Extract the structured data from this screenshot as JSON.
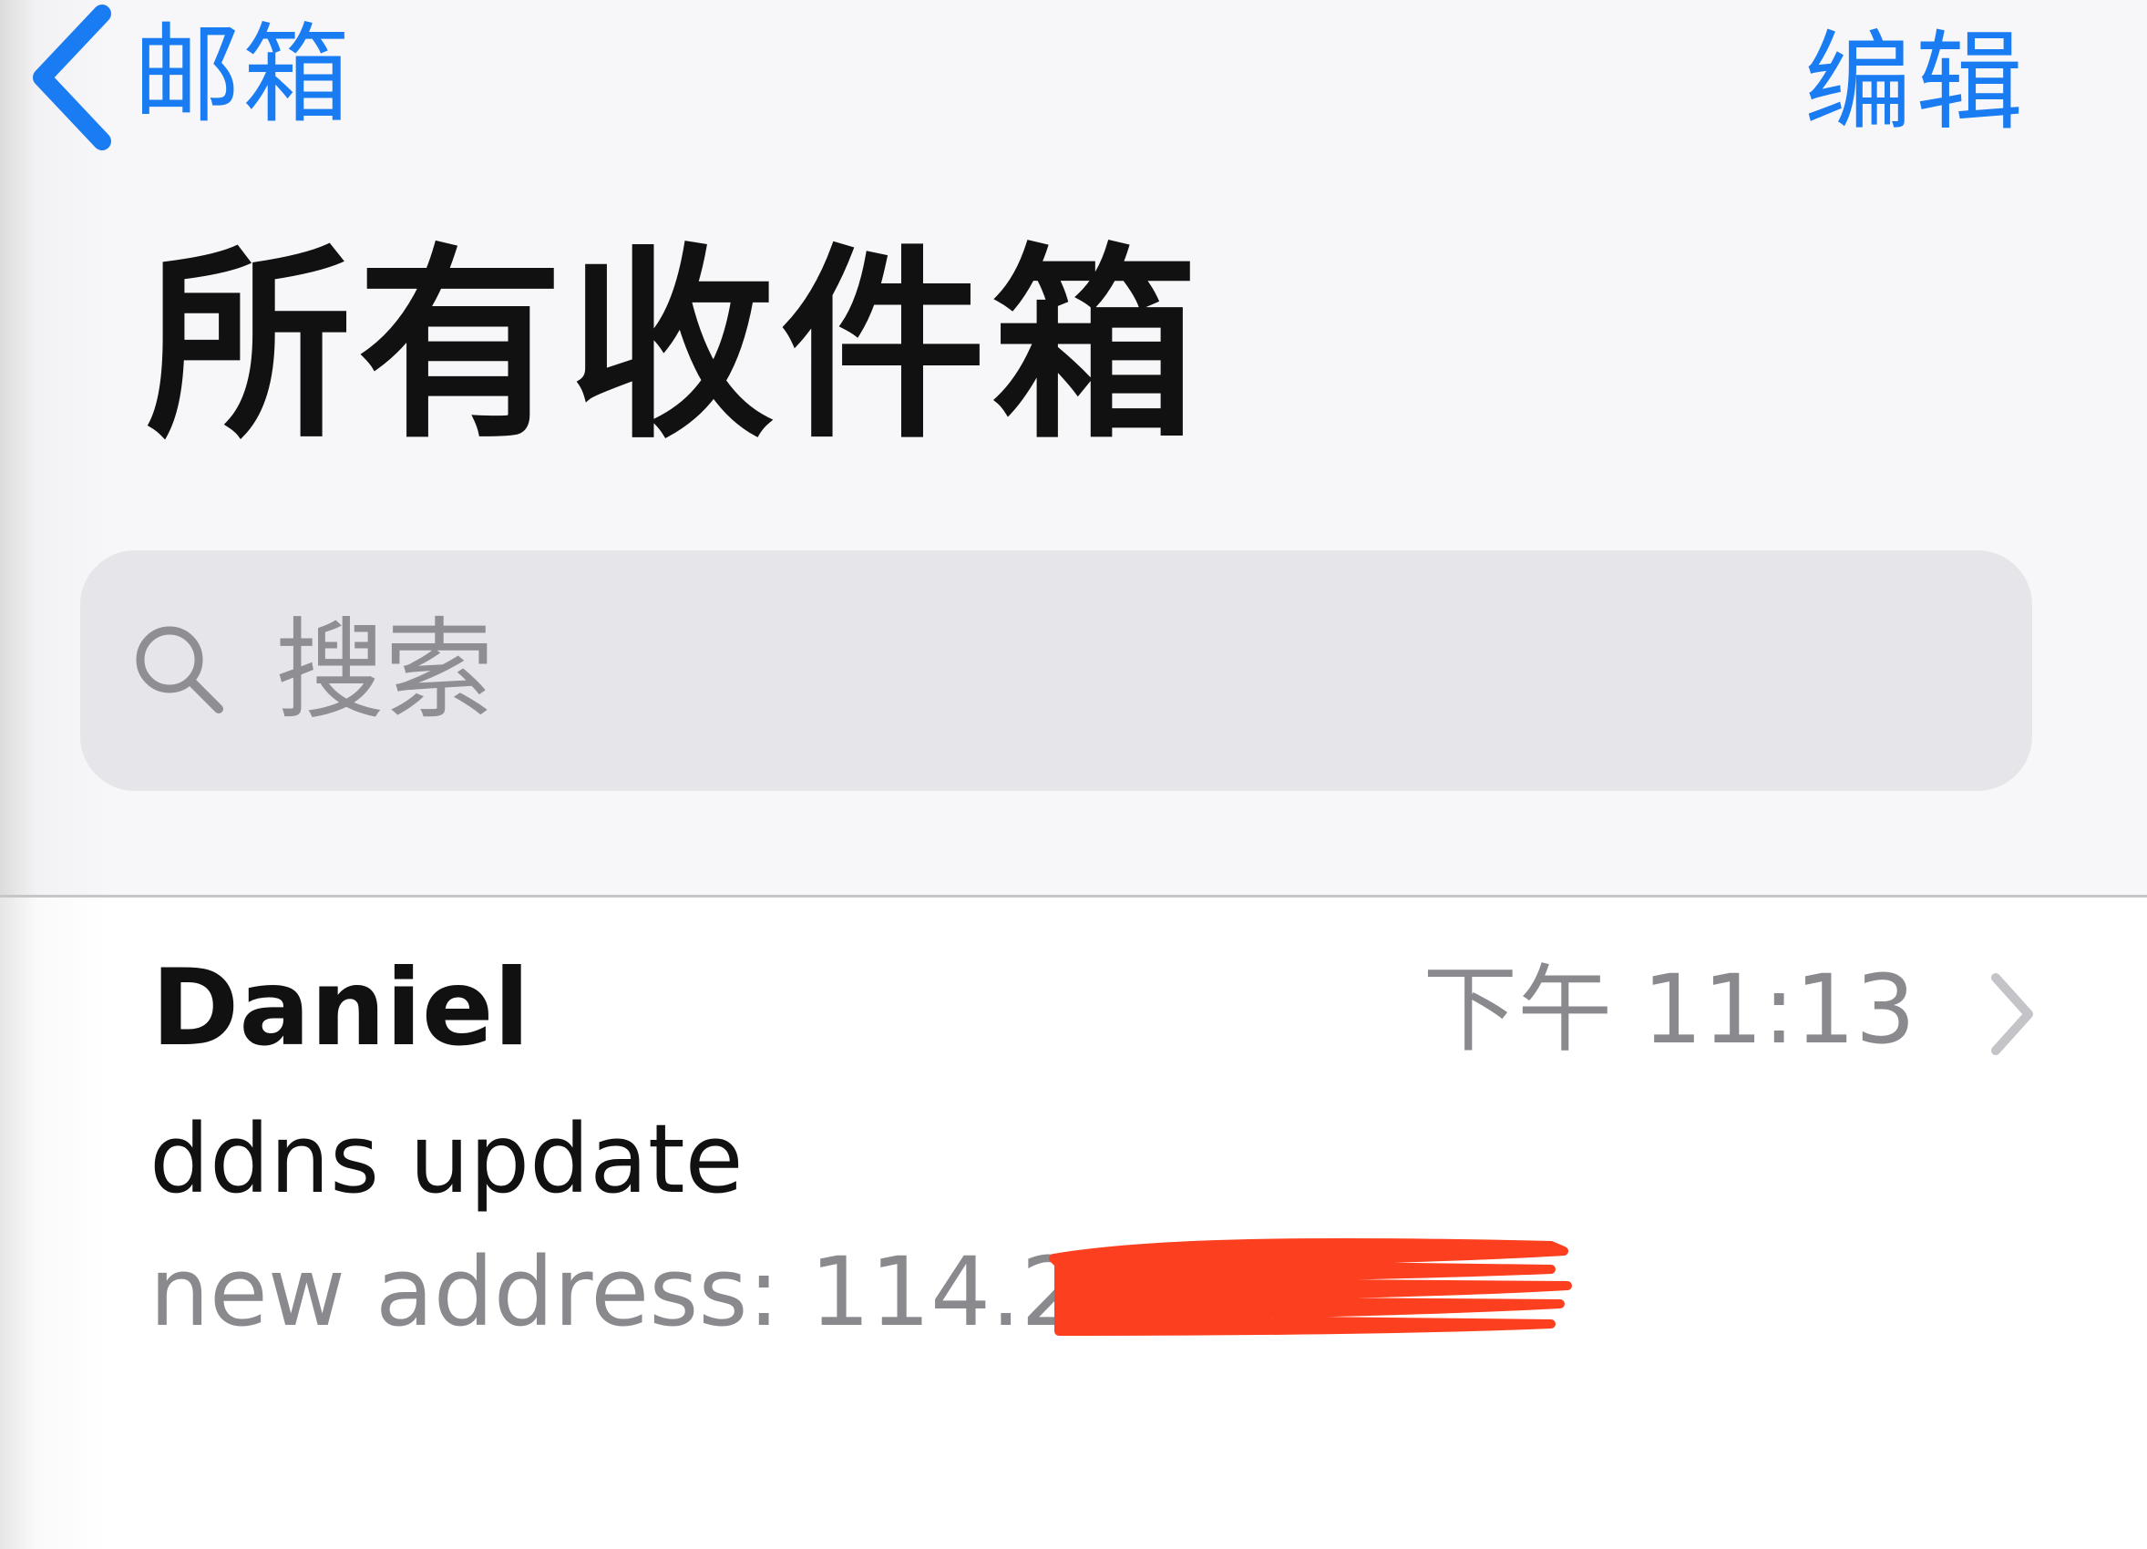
{
  "nav": {
    "back_label": "邮箱",
    "edit_label": "编辑"
  },
  "title": "所有收件箱",
  "search": {
    "placeholder": "搜索",
    "value": ""
  },
  "messages": [
    {
      "sender": "Daniel",
      "time": "下午 11:13",
      "subject": "ddns update",
      "preview": "new address: 114.25"
    }
  ],
  "colors": {
    "accent": "#1a7cf2",
    "redaction": "#fb3f1f",
    "secondary_text": "#8a8a8e",
    "search_bg": "#e5e5ea"
  },
  "icons": {
    "back": "chevron-left-icon",
    "search": "search-icon",
    "disclosure": "chevron-right-icon"
  }
}
